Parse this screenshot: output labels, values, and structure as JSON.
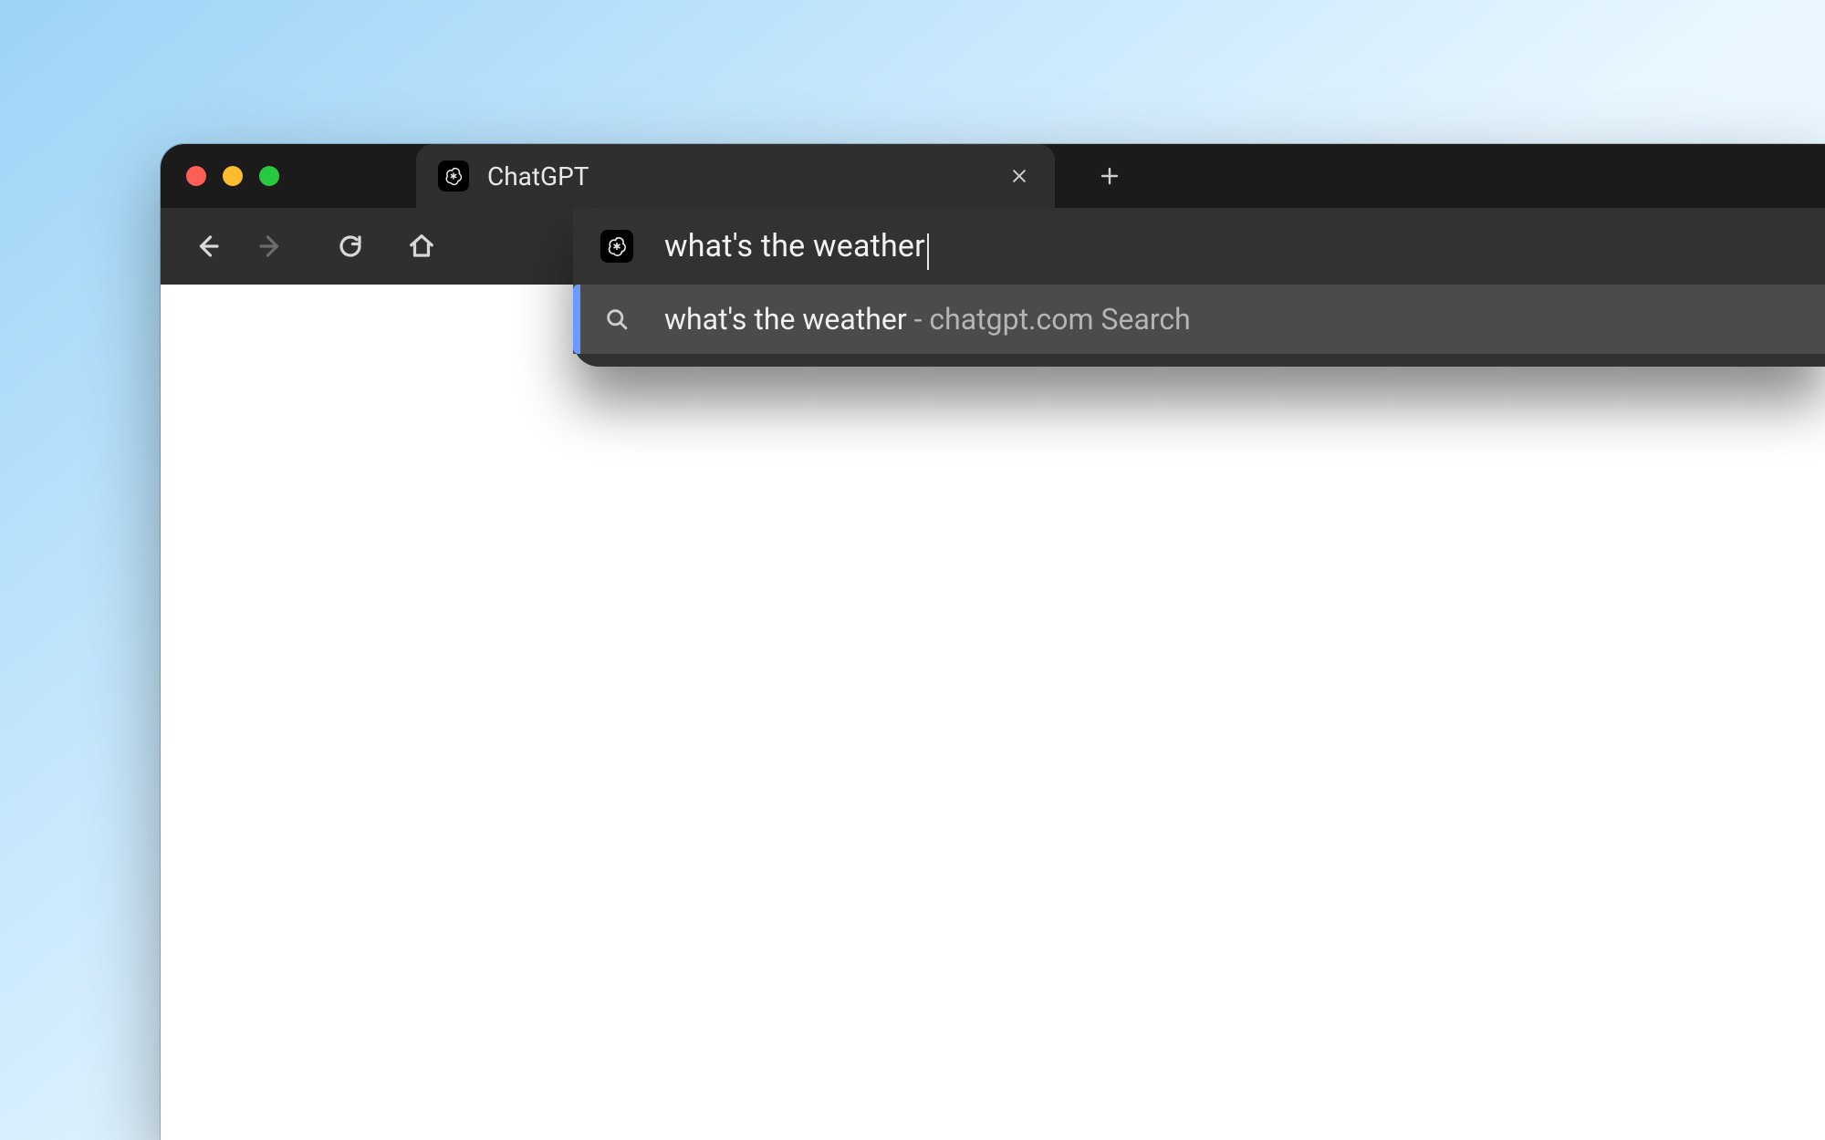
{
  "tab": {
    "title": "ChatGPT"
  },
  "omnibox": {
    "query": "what's the weather",
    "suggestion": {
      "query": "what's the weather",
      "separator": " - ",
      "source": "chatgpt.com Search"
    }
  }
}
